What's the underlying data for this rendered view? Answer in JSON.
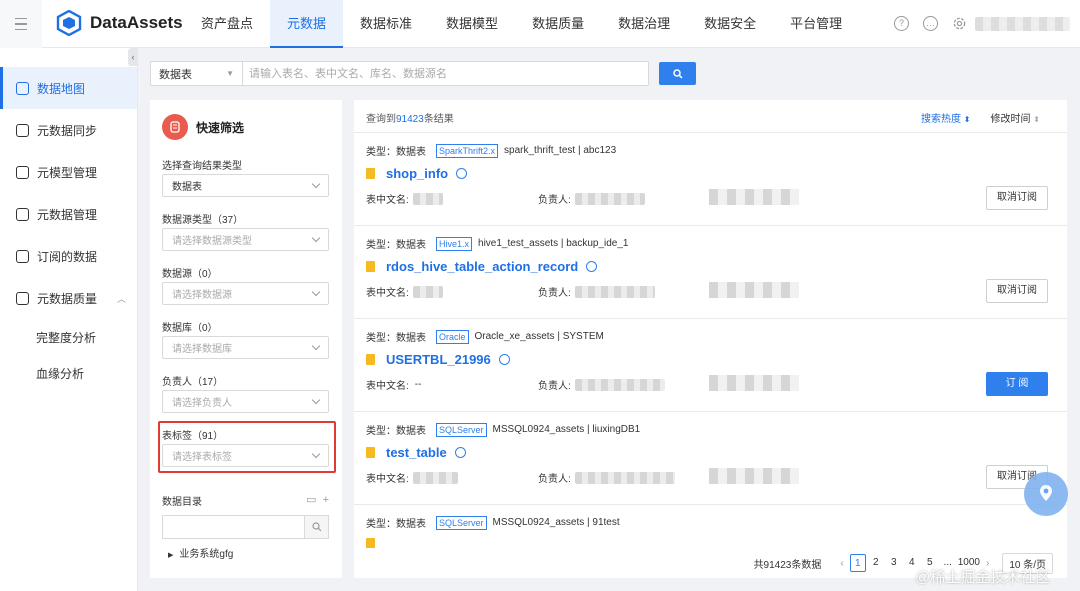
{
  "app": {
    "name": "DataAssets"
  },
  "nav": [
    "资产盘点",
    "元数据",
    "数据标准",
    "数据模型",
    "数据质量",
    "数据治理",
    "数据安全",
    "平台管理"
  ],
  "nav_active_index": 1,
  "sidebar": {
    "items": [
      {
        "label": "数据地图",
        "icon": "map-icon",
        "active": true
      },
      {
        "label": "元数据同步",
        "icon": "sync-icon"
      },
      {
        "label": "元模型管理",
        "icon": "cube-icon"
      },
      {
        "label": "元数据管理",
        "icon": "database-icon"
      },
      {
        "label": "订阅的数据",
        "icon": "subscribe-icon"
      },
      {
        "label": "元数据质量",
        "icon": "shield-icon",
        "expanded": true
      }
    ],
    "sub_items": [
      "完整度分析",
      "血缘分析"
    ]
  },
  "search": {
    "type": "数据表",
    "placeholder": "请输入表名、表中文名、库名、数据源名"
  },
  "filter": {
    "title": "快速筛选",
    "fields": [
      {
        "label": "选择查询结果类型",
        "value": "数据表",
        "placeholder": ""
      },
      {
        "label": "数据源类型（37）",
        "value": "",
        "placeholder": "请选择数据源类型"
      },
      {
        "label": "数据源（0）",
        "value": "",
        "placeholder": "请选择数据源"
      },
      {
        "label": "数据库（0）",
        "value": "",
        "placeholder": "请选择数据库"
      },
      {
        "label": "负责人（17）",
        "value": "",
        "placeholder": "请选择负责人"
      },
      {
        "label": "表标签（91）",
        "value": "",
        "placeholder": "请选择表标签"
      }
    ],
    "catalog_title": "数据目录",
    "tree": [
      "业务系统gfg"
    ]
  },
  "results": {
    "prefix": "查询到",
    "count": "91423",
    "suffix": "条结果",
    "sort_heat": "搜索热度",
    "sort_time": "修改时间",
    "cards": [
      {
        "type_label": "类型：数据表",
        "tag": "SparkThrift2.x",
        "path": "spark_thrift_test  |  abc123",
        "name": "shop_info",
        "cn_label": "表中文名:",
        "cn_value": "",
        "owner_label": "负责人:",
        "button": "取消订阅",
        "primary": false
      },
      {
        "type_label": "类型：数据表",
        "tag": "Hive1.x",
        "path": "hive1_test_assets  |  backup_ide_1",
        "name": "rdos_hive_table_action_record",
        "cn_label": "表中文名:",
        "cn_value": "",
        "owner_label": "负责人:",
        "button": "取消订阅",
        "primary": false
      },
      {
        "type_label": "类型：数据表",
        "tag": "Oracle",
        "path": "Oracle_xe_assets  |  SYSTEM",
        "name": "USERTBL_21996",
        "cn_label": "表中文名:",
        "cn_value": "--",
        "owner_label": "负责人:",
        "button": "订 阅",
        "primary": true
      },
      {
        "type_label": "类型：数据表",
        "tag": "SQLServer",
        "path": "MSSQL0924_assets  |  liuxingDB1",
        "name": "test_table",
        "cn_label": "表中文名:",
        "cn_value": "",
        "owner_label": "负责人:",
        "button": "取消订阅",
        "primary": false
      },
      {
        "type_label": "类型：数据表",
        "tag": "SQLServer",
        "path": "MSSQL0924_assets  |  91test",
        "name": "",
        "cn_label": "",
        "cn_value": "",
        "owner_label": "",
        "button": "",
        "primary": false
      }
    ]
  },
  "pager": {
    "total": "共91423条数据",
    "pages": [
      "1",
      "2",
      "3",
      "4",
      "5",
      "...",
      "1000"
    ],
    "size": "10 条/页"
  },
  "watermark": "@稀土掘金技术社区",
  "colors": {
    "primary": "#2f80ed",
    "highlight": "#e03a33",
    "filter_badge": "#e85b4d"
  }
}
